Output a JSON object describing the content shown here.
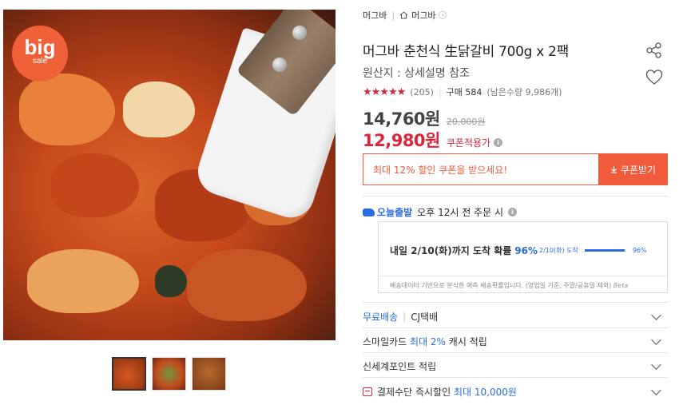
{
  "badge": {
    "line1": "big",
    "line2": "sale"
  },
  "breadcrumb": {
    "brand": "머그바",
    "store": "머그바"
  },
  "product": {
    "title": "머그바 춘천식 生닭갈비 700g x 2팩",
    "origin": "원산지 : 상세설명 참조",
    "rating_stars": "★★★★★",
    "review_count": "(205)",
    "purchase": "구매 584",
    "stock": "(남은수량 9,986개)"
  },
  "price": {
    "sale": "14,760원",
    "original": "20,000원",
    "coupon_price": "12,980원",
    "coupon_label": "쿠폰적용가"
  },
  "coupon": {
    "message": "최대 12% 할인 쿠폰을 받으세요!",
    "button": "쿠폰받기"
  },
  "delivery": {
    "tag": "오늘출발",
    "cutoff": "오후 12시 전 주문 시",
    "arrival": "내일 2/10(화)까지 도착 확률",
    "probability": "96%",
    "mini_label": "2/10(화) 도착",
    "mini_pct": "96%",
    "probability_fraction": 0.96,
    "note": "배송데이터 기반으로 분석한 예측 배송확률입니다. (영업일 기준, 주말/공휴일 제외)",
    "beta": "Beta"
  },
  "options": [
    {
      "label": "무료배송",
      "extra": "CJ택배"
    },
    {
      "label": "스마일카드",
      "highlight": "최대 2%",
      "suffix": "캐시 적립"
    },
    {
      "label": "신세계포인트 적립"
    },
    {
      "label": "결제수단 즉시할인",
      "highlight": "최대 10,000원"
    }
  ],
  "colors": {
    "accent_red": "#d9263d",
    "coupon_orange": "#f15a3a",
    "blue": "#2b6de0"
  }
}
